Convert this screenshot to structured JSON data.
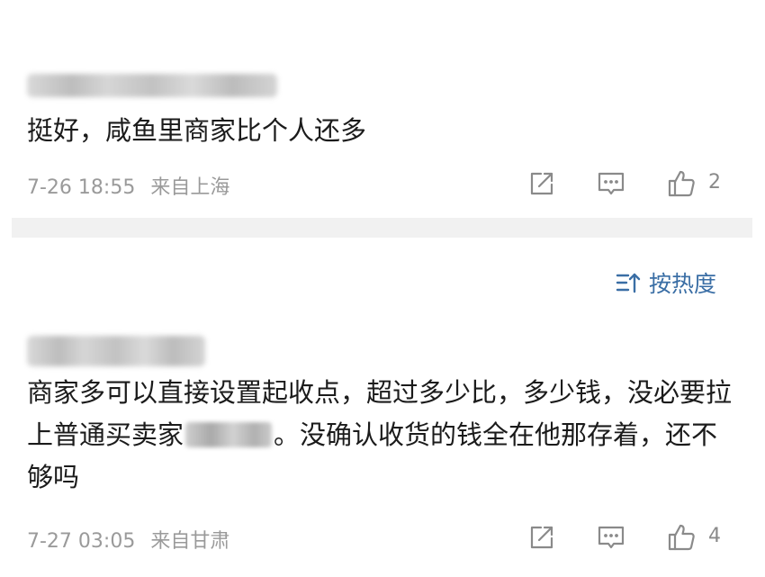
{
  "comments": [
    {
      "username_hidden": true,
      "text": "挺好，咸鱼里商家比个人还多",
      "timestamp": "7-26 18:55",
      "location": "来自上海",
      "likes": "2"
    },
    {
      "username_hidden": true,
      "text_part1": "商家多可以直接设置起收点，超过多少比，多少钱，没必要拉上普通买卖家",
      "text_part2": "。没确认收货的钱全在他那存着，还不够吗",
      "timestamp": "7-27 03:05",
      "location": "来自甘肃",
      "likes": "4"
    }
  ],
  "sort": {
    "label": "按热度",
    "icon": "sort-icon"
  },
  "icons": [
    "share-icon",
    "reply-icon",
    "like-icon"
  ],
  "colors": {
    "accent": "#3a6ea5",
    "meta_text": "#9a9a9a",
    "separator": "#f1f1f1"
  }
}
